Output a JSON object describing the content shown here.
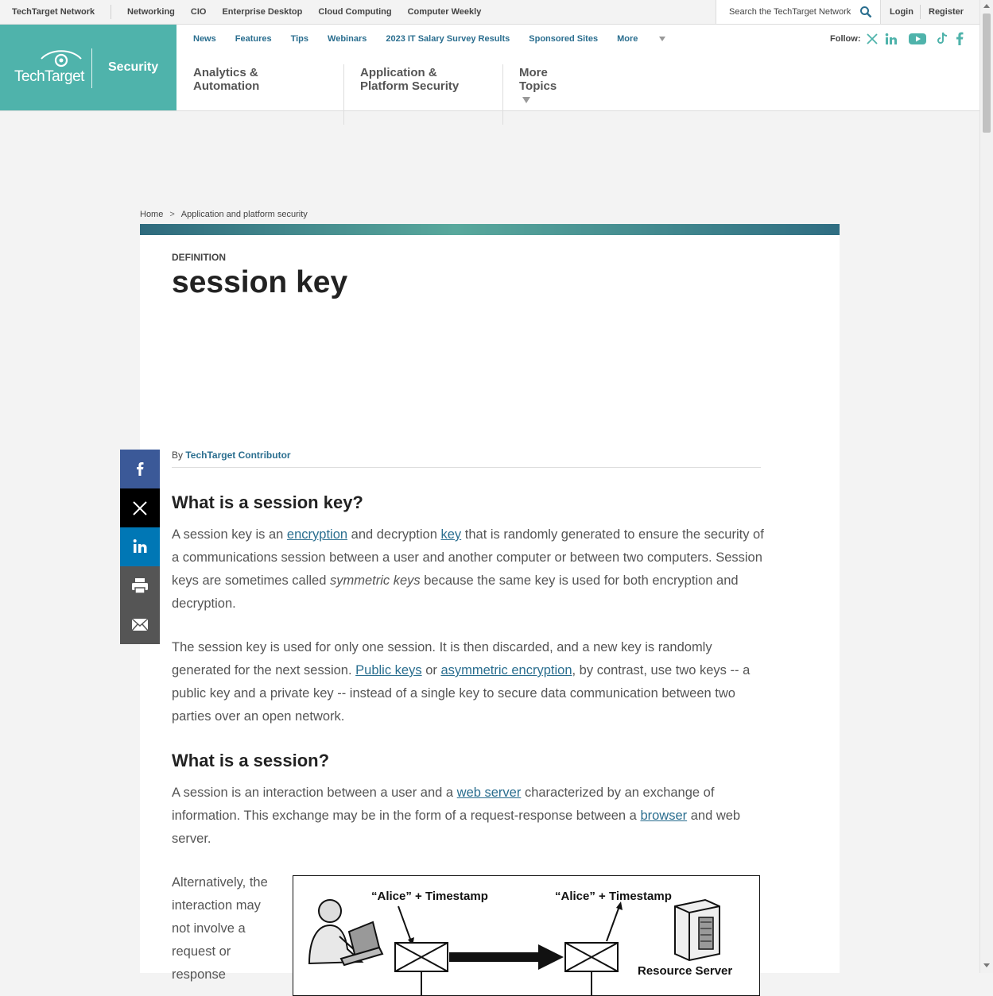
{
  "network_bar": {
    "brand": "TechTarget Network",
    "links": [
      "Networking",
      "CIO",
      "Enterprise Desktop",
      "Cloud Computing",
      "Computer Weekly"
    ],
    "search_placeholder": "Search the TechTarget Network",
    "login": "Login",
    "register": "Register"
  },
  "header": {
    "logo_text": "TechTarget",
    "site_section": "Security",
    "subnav": [
      "News",
      "Features",
      "Tips",
      "Webinars",
      "2023 IT Salary Survey Results",
      "Sponsored Sites",
      "More"
    ],
    "topics": [
      "Analytics & Automation",
      "Application & Platform Security",
      "More Topics"
    ],
    "follow_label": "Follow:"
  },
  "breadcrumb": {
    "home": "Home",
    "separator": ">",
    "current": "Application and platform security"
  },
  "article": {
    "label": "DEFINITION",
    "title": "session key",
    "by": "By",
    "author": "TechTarget Contributor",
    "h_what_is_session_key": "What is a session key?",
    "p1": {
      "t1": "A session key is an ",
      "l1": "encryption",
      "t2": " and decryption ",
      "l2": "key",
      "t3": " that is randomly generated to ensure the security of a communications session between a user and another computer or between two computers. Session keys are sometimes called ",
      "em": "symmetric keys",
      "t4": " because the same key is used for both encryption and decryption."
    },
    "p2": {
      "t1": "The session key is used for only one session. It is then discarded, and a new key is randomly generated for the next session. ",
      "l1": "Public keys",
      "t2": " or ",
      "l2": "asymmetric encryption",
      "t3": ", by contrast, use two keys -- a public key and a private key -- instead of a single key to secure data communication between two parties over an open network."
    },
    "h_what_is_session": "What is a session?",
    "p3": {
      "t1": "A session is an interaction between a user and a ",
      "l1": "web server",
      "t2": " characterized by an exchange of information. This exchange may be in the form of a request-response between a ",
      "l2": "browser",
      "t3": " and web server."
    },
    "p4": "Alternatively, the interaction may not involve a request or response"
  },
  "diagram": {
    "label_left": "“Alice” + Timestamp",
    "label_right": "“Alice” + Timestamp",
    "label_server": "Resource Server"
  },
  "share": [
    "facebook-icon",
    "x-icon",
    "linkedin-icon",
    "print-icon",
    "email-icon"
  ],
  "colors": {
    "accent": "#4fb3ab",
    "link": "#2a6e8f"
  }
}
